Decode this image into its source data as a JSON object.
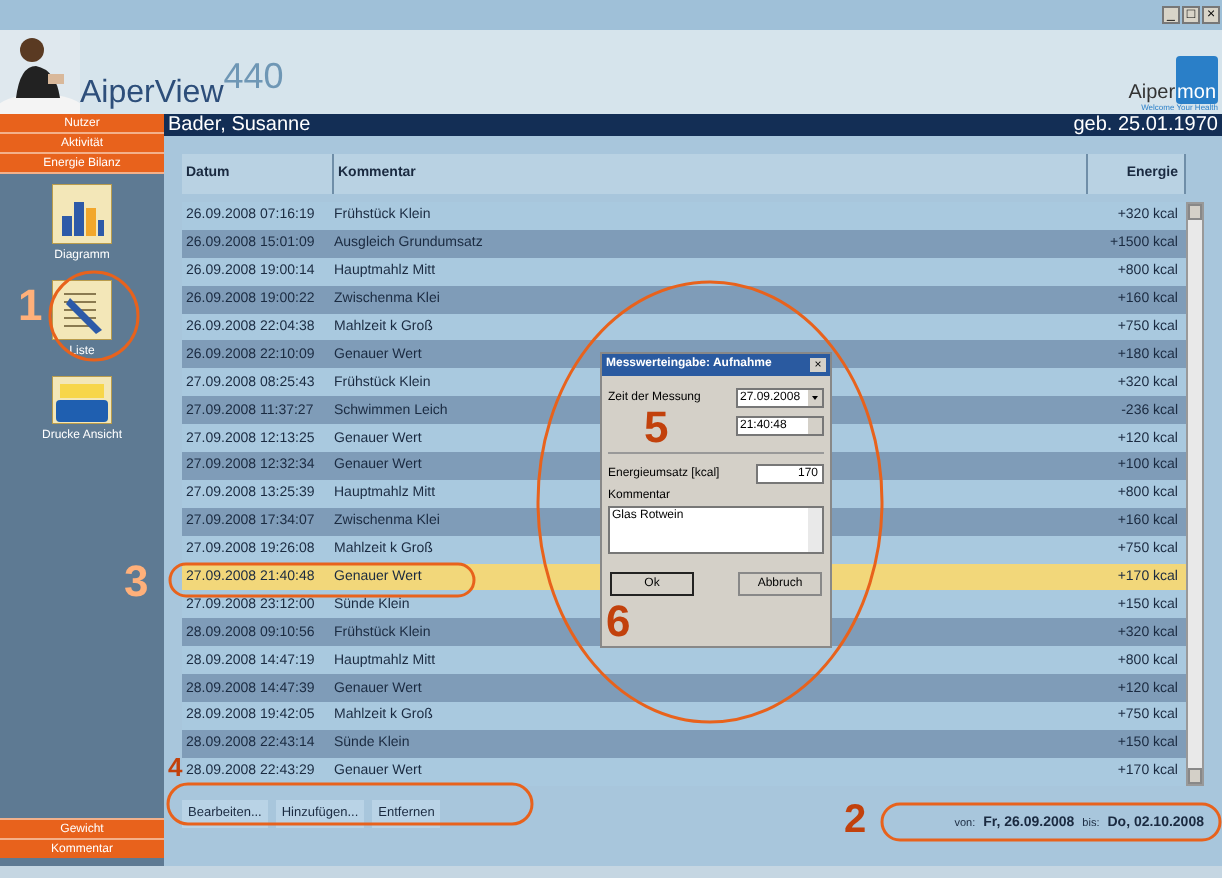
{
  "header": {
    "app_name": "AiperView",
    "app_version": "440",
    "brand_left": "Aiper",
    "brand_right": "mon",
    "tagline": "Welcome Your Health",
    "window_controls": [
      "_",
      "□",
      "×"
    ]
  },
  "sidebar": {
    "nav_top": [
      "Nutzer",
      "Aktivität",
      "Energie Bilanz"
    ],
    "tools": [
      {
        "label": "Diagramm",
        "kind": "chart"
      },
      {
        "label": "Liste",
        "kind": "list"
      },
      {
        "label": "Drucke Ansicht",
        "kind": "print"
      }
    ],
    "nav_bottom": [
      "Gewicht",
      "Kommentar"
    ]
  },
  "person": {
    "name": "Bader, Susanne",
    "birth": "geb. 25.01.1970"
  },
  "table": {
    "columns": [
      "Datum",
      "Kommentar",
      "Energie"
    ],
    "rows": [
      {
        "datum": "26.09.2008 07:16:19",
        "kommentar": "Frühstück Klein",
        "energie": "+320 kcal",
        "selected": false
      },
      {
        "datum": "26.09.2008 15:01:09",
        "kommentar": "Ausgleich Grundumsatz",
        "energie": "+1500 kcal",
        "selected": false
      },
      {
        "datum": "26.09.2008 19:00:14",
        "kommentar": "Hauptmahlz Mitt",
        "energie": "+800 kcal",
        "selected": false
      },
      {
        "datum": "26.09.2008 19:00:22",
        "kommentar": "Zwischenma Klei",
        "energie": "+160 kcal",
        "selected": false
      },
      {
        "datum": "26.09.2008 22:04:38",
        "kommentar": "Mahlzeit k Groß",
        "energie": "+750 kcal",
        "selected": false
      },
      {
        "datum": "26.09.2008 22:10:09",
        "kommentar": "Genauer Wert",
        "energie": "+180 kcal",
        "selected": false
      },
      {
        "datum": "27.09.2008 08:25:43",
        "kommentar": "Frühstück Klein",
        "energie": "+320 kcal",
        "selected": false
      },
      {
        "datum": "27.09.2008 11:37:27",
        "kommentar": "Schwimmen Leich",
        "energie": "-236 kcal",
        "selected": false
      },
      {
        "datum": "27.09.2008 12:13:25",
        "kommentar": "Genauer Wert",
        "energie": "+120 kcal",
        "selected": false
      },
      {
        "datum": "27.09.2008 12:32:34",
        "kommentar": "Genauer Wert",
        "energie": "+100 kcal",
        "selected": false
      },
      {
        "datum": "27.09.2008 13:25:39",
        "kommentar": "Hauptmahlz Mitt",
        "energie": "+800 kcal",
        "selected": false
      },
      {
        "datum": "27.09.2008 17:34:07",
        "kommentar": "Zwischenma Klei",
        "energie": "+160 kcal",
        "selected": false
      },
      {
        "datum": "27.09.2008 19:26:08",
        "kommentar": "Mahlzeit k Groß",
        "energie": "+750 kcal",
        "selected": false
      },
      {
        "datum": "27.09.2008 21:40:48",
        "kommentar": "Genauer Wert",
        "energie": "+170 kcal",
        "selected": true
      },
      {
        "datum": "27.09.2008 23:12:00",
        "kommentar": "Sünde Klein",
        "energie": "+150 kcal",
        "selected": false
      },
      {
        "datum": "28.09.2008 09:10:56",
        "kommentar": "Frühstück Klein",
        "energie": "+320 kcal",
        "selected": false
      },
      {
        "datum": "28.09.2008 14:47:19",
        "kommentar": "Hauptmahlz Mitt",
        "energie": "+800 kcal",
        "selected": false
      },
      {
        "datum": "28.09.2008 14:47:39",
        "kommentar": "Genauer Wert",
        "energie": "+120 kcal",
        "selected": false
      },
      {
        "datum": "28.09.2008 19:42:05",
        "kommentar": "Mahlzeit k Groß",
        "energie": "+750 kcal",
        "selected": false
      },
      {
        "datum": "28.09.2008 22:43:14",
        "kommentar": "Sünde Klein",
        "energie": "+150 kcal",
        "selected": false
      },
      {
        "datum": "28.09.2008 22:43:29",
        "kommentar": "Genauer Wert",
        "energie": "+170 kcal",
        "selected": false
      }
    ]
  },
  "actions": [
    "Bearbeiten...",
    "Hinzufügen...",
    "Entfernen"
  ],
  "range": {
    "from_label": "von:",
    "from": "Fr, 26.09.2008",
    "to_label": "bis:",
    "to": "Do, 02.10.2008"
  },
  "dialog": {
    "title": "Messwerteingabe: Aufnahme",
    "close": "×",
    "time_label": "Zeit der Messung",
    "date": "27.09.2008",
    "time": "21:40:48",
    "energy_label": "Energieumsatz [kcal]",
    "energy": "170",
    "comment_label": "Kommentar",
    "comment": "Glas Rotwein",
    "buttons": [
      "Ok",
      "Abbruch"
    ]
  },
  "annotations": [
    "1",
    "2",
    "3",
    "4",
    "5",
    "6"
  ]
}
